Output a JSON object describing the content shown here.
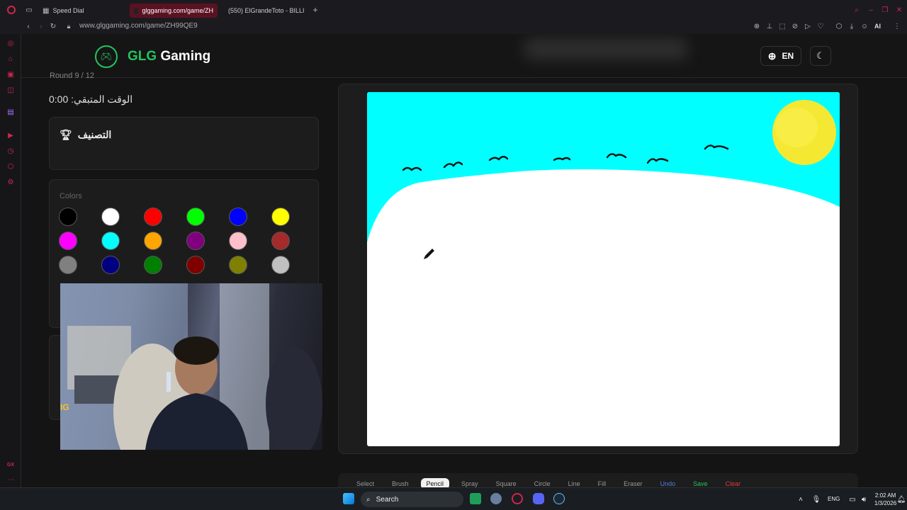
{
  "browser": {
    "tabs": [
      {
        "label": "Speed Dial"
      },
      {
        "label": "glggaming.com/game/ZH"
      },
      {
        "label": "(550) ElGrandeToto - BILLI"
      }
    ],
    "url": "www.glggaming.com/game/ZH99QE9",
    "ai_label": "AI"
  },
  "header": {
    "brand_accent": "GLG",
    "brand_rest": "Gaming",
    "language": "EN"
  },
  "game": {
    "round_label": "Round 9 / 12",
    "time_left": "الوقت المتبقي: 0:00",
    "leaderboard_title": "التصنيف",
    "colors_label": "Colors",
    "palette": [
      "#000000",
      "#ffffff",
      "#ff0000",
      "#00ff00",
      "#0000ff",
      "#ffff00",
      "#ff00ff",
      "#00ffff",
      "#ffa500",
      "#800080",
      "#ffc0cb",
      "#a52a2a",
      "#808080",
      "#000080",
      "#008000",
      "#800000",
      "#808000",
      "#c0c0c0"
    ],
    "toolbar": [
      "Select",
      "Brush",
      "Pencil",
      "Spray",
      "Square",
      "Circle",
      "Line",
      "Fill",
      "Eraser",
      "Undo",
      "Save",
      "Clear"
    ],
    "active_tool": "Pencil"
  },
  "overlay": {
    "webcam_sign": "IG"
  },
  "taskbar": {
    "search": "Search",
    "lang": "ENG",
    "time": "2:02 AM",
    "date": "1/3/2026"
  },
  "colors": {
    "accent": "#22c55e",
    "sky": "#00ffff",
    "sun": "#f5e833",
    "opera": "#d0264a"
  }
}
